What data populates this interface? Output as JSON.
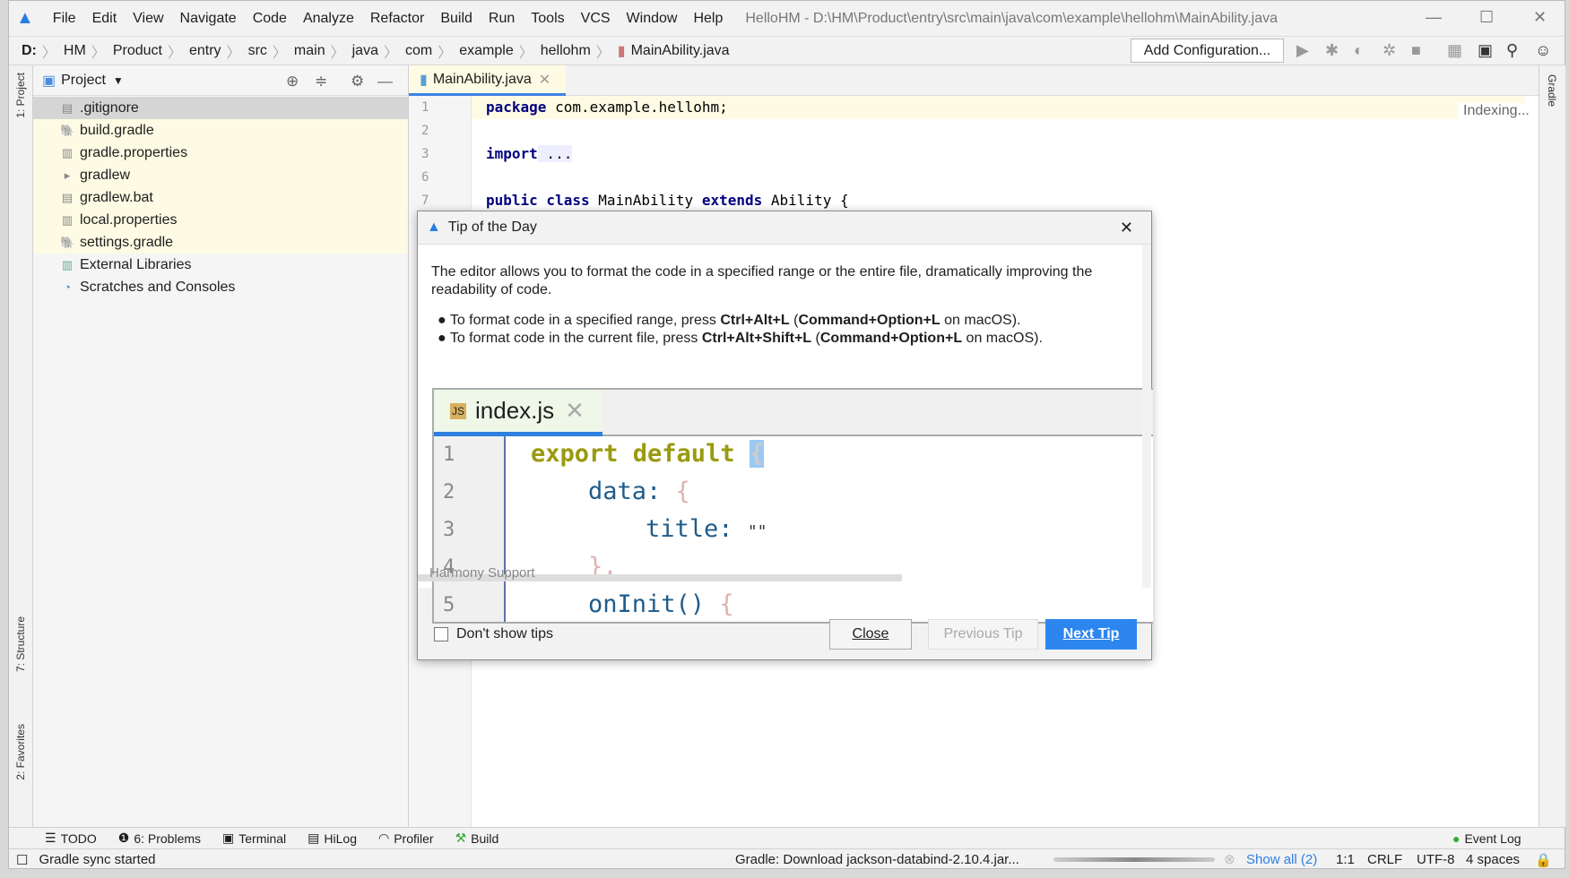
{
  "window": {
    "title": "HelloHM - D:\\HM\\Product\\entry\\src\\main\\java\\com\\example\\hellohm\\MainAbility.java"
  },
  "menu": [
    "File",
    "Edit",
    "View",
    "Navigate",
    "Code",
    "Analyze",
    "Refactor",
    "Build",
    "Run",
    "Tools",
    "VCS",
    "Window",
    "Help"
  ],
  "breadcrumb": [
    "D:",
    "HM",
    "Product",
    "entry",
    "src",
    "main",
    "java",
    "com",
    "example",
    "hellohm",
    "MainAbility.java"
  ],
  "toolbar": {
    "add_configuration": "Add Configuration..."
  },
  "left_stripe": {
    "project": "1: Project",
    "structure": "7: Structure",
    "favorites": "2: Favorites"
  },
  "right_stripe": {
    "gradle": "Gradle"
  },
  "project": {
    "title": "Project",
    "items": [
      {
        "label": ".gitignore",
        "icon": "file-icon"
      },
      {
        "label": "build.gradle",
        "icon": "gradle-icon"
      },
      {
        "label": "gradle.properties",
        "icon": "properties-icon"
      },
      {
        "label": "gradlew",
        "icon": "script-icon"
      },
      {
        "label": "gradlew.bat",
        "icon": "file-icon"
      },
      {
        "label": "local.properties",
        "icon": "properties-icon"
      },
      {
        "label": "settings.gradle",
        "icon": "gradle-icon"
      },
      {
        "label": "External Libraries",
        "icon": "library-icon"
      },
      {
        "label": "Scratches and Consoles",
        "icon": "scratches-icon"
      }
    ]
  },
  "editor": {
    "tab": "MainAbility.java",
    "indexing": "Indexing...",
    "lines": [
      {
        "n": "1",
        "kw": "package",
        "rest": " com.example.hellohm;"
      },
      {
        "n": "2",
        "kw": "",
        "rest": ""
      },
      {
        "n": "3",
        "kw": "import",
        "rest": " ..."
      },
      {
        "n": "6",
        "kw": "",
        "rest": ""
      },
      {
        "n": "7",
        "kw": "public class",
        "rest": " MainAbility ",
        "kw2": "extends",
        "rest2": " Ability {"
      }
    ]
  },
  "dialog": {
    "title": "Tip of the Day",
    "intro": "The editor allows you to format the code in a specified range or the entire file, dramatically improving the readability of code.",
    "bullets": [
      {
        "a": "To format code in a specified range, press ",
        "b": "Ctrl+Alt+L",
        "c": " (",
        "d": "Command+Option+L",
        "e": " on macOS)."
      },
      {
        "a": "To format code in the current file, press ",
        "b": "Ctrl+Alt+Shift+L",
        "c": " (",
        "d": "Command+Option+L",
        "e": " on macOS)."
      }
    ],
    "preview": {
      "tab": "index.js",
      "lines": [
        "1",
        "2",
        "3",
        "4",
        "5"
      ],
      "code": [
        "export default",
        "data:",
        "title:",
        "},",
        "onInit()"
      ],
      "braces": [
        "{",
        "{",
        "\"\"",
        "",
        "{"
      ]
    },
    "source": "Harmony Support",
    "dont_show": "Don't show tips",
    "dont_show_checked": false,
    "close": "Close",
    "previous": "Previous Tip",
    "next": "Next Tip"
  },
  "bottom_tools": [
    "TODO",
    "6: Problems",
    "Terminal",
    "HiLog",
    "Profiler",
    "Build"
  ],
  "event_log": "Event Log",
  "status": {
    "message": "Gradle sync started",
    "progress_text": "Gradle: Download jackson-databind-2.10.4.jar...",
    "show_all": "Show all (2)",
    "position": "1:1",
    "line_sep": "CRLF",
    "encoding": "UTF-8",
    "indent": "4 spaces"
  },
  "colors": {
    "accent": "#3d82e6",
    "next_button": "#2d86f0",
    "keyword": "#000080",
    "current_line": "#fdfbe3"
  }
}
